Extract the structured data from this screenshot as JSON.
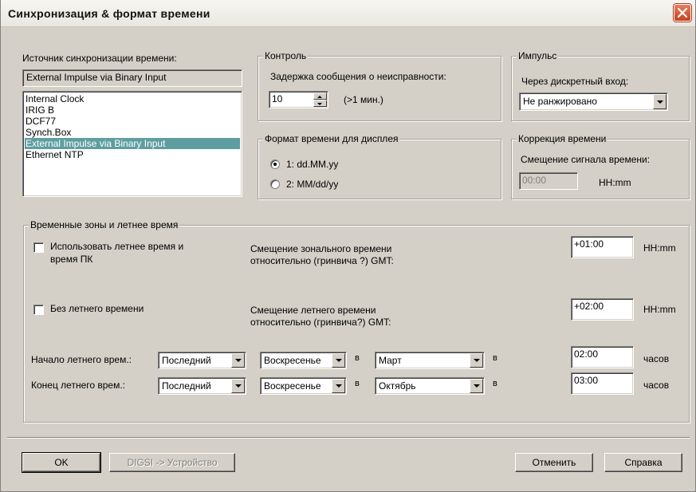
{
  "window": {
    "title": "Синхронизация & формат времени"
  },
  "source": {
    "label": "Источник синхронизации времени:",
    "current_value": "External Impulse via Binary Input",
    "options": [
      "Internal Clock",
      "IRIG B",
      "DCF77",
      "Synch.Box",
      "External Impulse via Binary Input",
      "Ethernet NTP"
    ],
    "selected_index": 4
  },
  "control": {
    "group_title": "Контроль",
    "delay_label": "Задержка сообщения о неисправности:",
    "delay_value": "10",
    "delay_hint": "(>1 мин.)"
  },
  "impulse": {
    "group_title": "Импульс",
    "input_label": "Через дискретный вход:",
    "input_value": "Не ранжировано"
  },
  "display_format": {
    "group_title": "Формат времени для дисплея",
    "options": [
      "1: dd.MM.yy",
      "2: MM/dd/yy"
    ],
    "selected_index": 0
  },
  "correction": {
    "group_title": "Коррекция времени",
    "offset_label": "Смещение сигнала времени:",
    "offset_value": "00:00",
    "offset_unit": "HH:mm"
  },
  "timezones": {
    "group_title": "Временные зоны и летнее время",
    "use_dst_pc_label_1": "Использовать летнее время и",
    "use_dst_pc_label_2": "время ПК",
    "use_dst_pc_checked": false,
    "zone_offset_label_1": "Смещение зонального времени",
    "zone_offset_label_2": "относительно (гринвича ?) GMT:",
    "zone_offset_value": "+01:00",
    "zone_offset_unit": "HH:mm",
    "no_dst_label": "Без летнего времени",
    "no_dst_checked": false,
    "dst_offset_label_1": "Смещение летнего времени",
    "dst_offset_label_2": "относительно (гринвича?) GMT:",
    "dst_offset_value": "+02:00",
    "dst_offset_unit": "HH:mm",
    "dst_start": {
      "label": "Начало летнего врем.:",
      "week": "Последний",
      "weekday": "Воскресенье",
      "in_1": "в",
      "month": "Март",
      "in_2": "в",
      "time": "02:00",
      "unit": "часов"
    },
    "dst_end": {
      "label": "Конец летнего врем.:",
      "week": "Последний",
      "weekday": "Воскресенье",
      "in_1": "в",
      "month": "Октябрь",
      "in_2": "в",
      "time": "03:00",
      "unit": "часов"
    }
  },
  "buttons": {
    "ok": "OK",
    "digsi": "DIGSI -> Устройство",
    "cancel": "Отменить",
    "help": "Справка"
  }
}
